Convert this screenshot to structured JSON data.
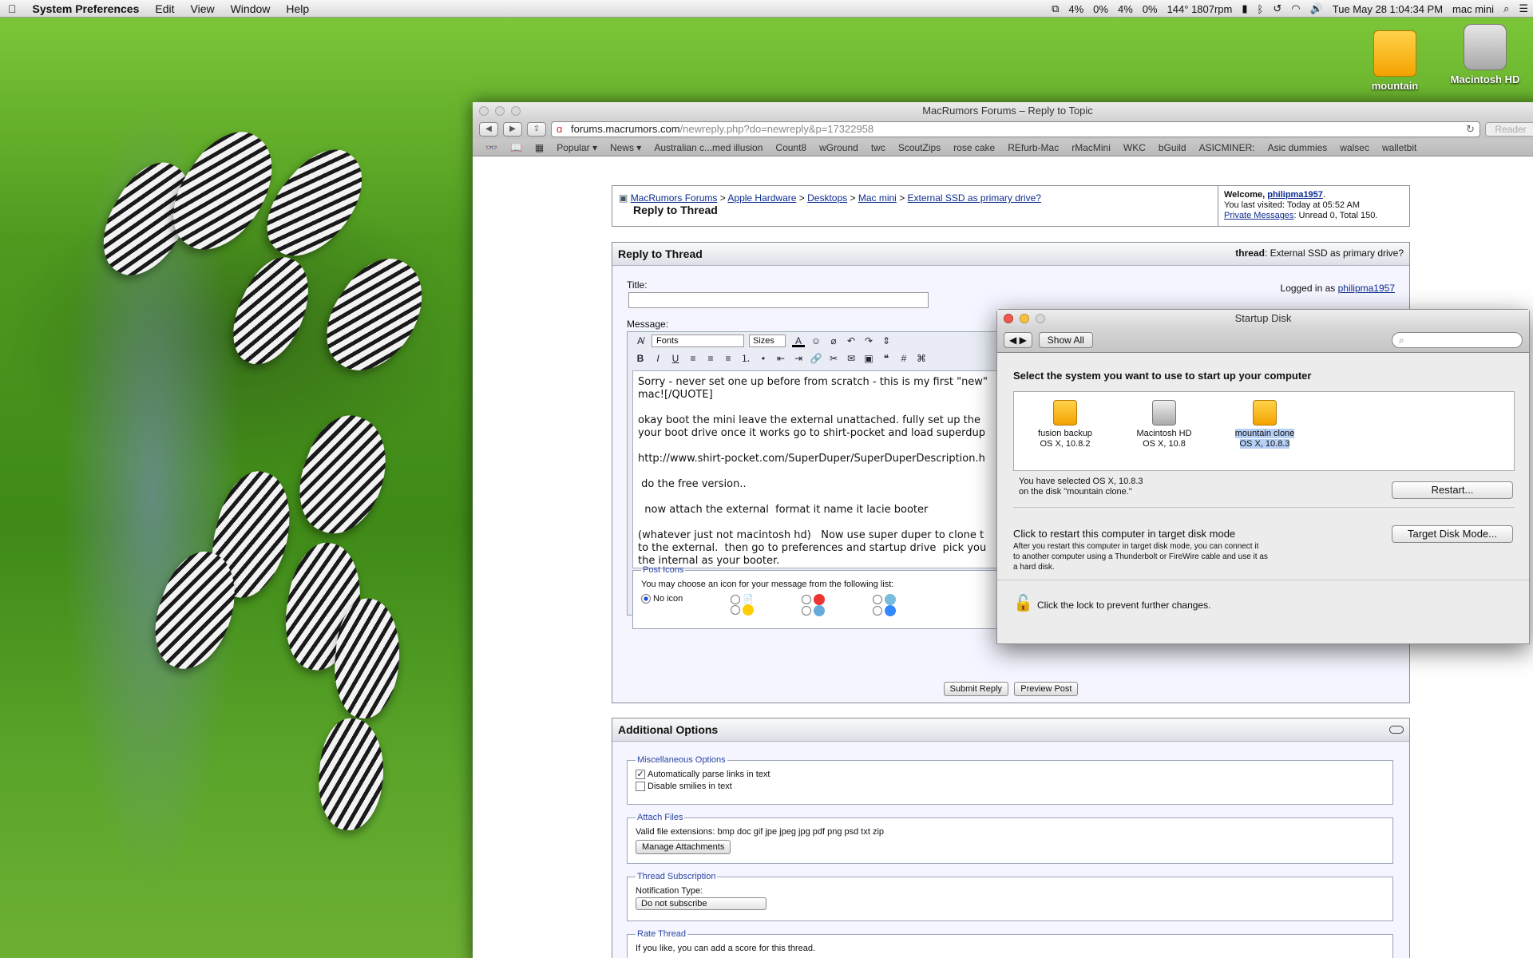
{
  "menubar": {
    "app": "System Preferences",
    "items": [
      "Edit",
      "View",
      "Window",
      "Help"
    ],
    "status": [
      "4%",
      "0%",
      "4%",
      "0%",
      "144° 1807rpm",
      "Tue May 28  1:04:34 PM",
      "mac mini"
    ]
  },
  "desktop": {
    "icons": [
      {
        "label": "mountain"
      },
      {
        "label": "Macintosh HD"
      }
    ]
  },
  "safari": {
    "title": "MacRumors Forums – Reply to Topic",
    "url_domain": "forums.macrumors.com",
    "url_path": "/newreply.php?do=newreply&p=17322958",
    "reader": "Reader",
    "bookmarks": [
      "Popular ▾",
      "News ▾",
      "Australian c...med illusion",
      "Count8",
      "wGround",
      "twc",
      "ScoutZips",
      "rose cake",
      "REfurb-Mac",
      "rMacMini",
      "WKC",
      "bGuild",
      "ASICMINER:",
      "Asic dummies",
      "walsec",
      "walletbit"
    ]
  },
  "forum": {
    "breadcrumb": [
      "MacRumors Forums",
      "Apple Hardware",
      "Desktops",
      "Mac mini",
      "External SSD as primary drive?"
    ],
    "page_heading": "Reply to Thread",
    "welcome": "Welcome,",
    "username": "philipma1957",
    "last_visited": "You last visited: Today at 05:52 AM",
    "pm_link": "Private Messages",
    "pm_text": ": Unread 0, Total 150.",
    "reply_panel": {
      "title": "Reply to Thread",
      "thread_label": "thread",
      "thread_title": ": External SSD as primary drive?",
      "title_label": "Title:",
      "logged_in": "Logged in as",
      "message_label": "Message:",
      "fonts": "Fonts",
      "sizes": "Sizes",
      "message_lines": [
        "Sorry - never set one up before from scratch - this is my first \"new\"",
        "mac![/QUOTE]",
        "",
        "okay boot the mini leave the external unattached. fully set up the",
        "your boot drive once it works go to shirt-pocket and load superdup",
        "",
        "http://www.shirt-pocket.com/SuperDuper/SuperDuperDescription.h",
        "",
        "do the free version..",
        "",
        "now attach the external  format it name it lacie booter",
        "",
        "(whatever just not macintosh hd)   Now use super duper to clone t",
        "to the external.  then go to preferences and startup drive  pick you",
        "the internal as your booter."
      ],
      "post_icons_legend": "Post Icons",
      "post_icons_text": "You may choose an icon for your message from the following list:",
      "no_icon": "No icon",
      "submit": "Submit Reply",
      "preview": "Preview Post"
    },
    "options": {
      "title": "Additional Options",
      "misc_legend": "Miscellaneous Options",
      "parse_links": "Automatically parse links in text",
      "disable_smilies": "Disable smilies in text",
      "attach_legend": "Attach Files",
      "extensions": "Valid file extensions: bmp doc gif jpe jpeg jpg pdf png psd txt zip",
      "manage": "Manage Attachments",
      "sub_legend": "Thread Subscription",
      "notify_label": "Notification Type:",
      "notify_value": "Do not subscribe",
      "rate_legend": "Rate Thread",
      "rate_text": "If you like, you can add a score for this thread."
    }
  },
  "startup_disk": {
    "title": "Startup Disk",
    "show_all": "Show All",
    "prompt": "Select the system you want to use to start up your computer",
    "disks": [
      {
        "name": "fusion backup",
        "os": "OS X, 10.8.2"
      },
      {
        "name": "Macintosh HD",
        "os": "OS X, 10.8"
      },
      {
        "name": "mountain clone",
        "os": "OS X, 10.8.3"
      }
    ],
    "selected_line1": "You have selected OS X, 10.8.3",
    "selected_line2": "on the disk \"mountain clone.\"",
    "restart": "Restart...",
    "tdm_title": "Click to restart this computer in target disk mode",
    "tdm_line1": "After you restart this computer in target disk mode, you can connect it",
    "tdm_line2": "to another computer using a Thunderbolt or FireWire cable and use it as",
    "tdm_line3": "a hard disk.",
    "tdm_button": "Target Disk Mode...",
    "lock_text": "Click the lock to prevent further changes."
  }
}
